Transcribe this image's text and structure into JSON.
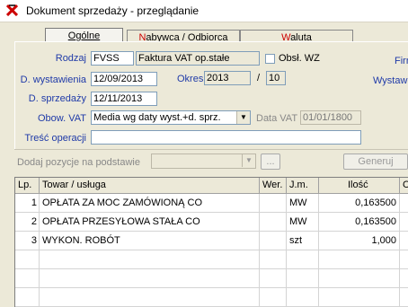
{
  "window": {
    "title": "Dokument sprzedaży  - przeglądanie"
  },
  "tabs": [
    {
      "label_pre": "",
      "hotkey": "O",
      "label_post": "gólne"
    },
    {
      "label_pre": "",
      "hotkey": "N",
      "label_post": "abywca / Odbiorca"
    },
    {
      "label_pre": "",
      "hotkey": "W",
      "label_post": "aluta"
    }
  ],
  "form": {
    "rodzaj_label": "Rodzaj",
    "rodzaj_code": "FVSS",
    "rodzaj_name": "Faktura VAT op.stałe",
    "obsl_wz_label": "Obsł. WZ",
    "firma_label": "Firm",
    "d_wystawienia_label": "D. wystawienia",
    "d_wystawienia": "12/09/2013",
    "okres_label": "Okres",
    "okres_year": "2013",
    "okres_slash": "/",
    "okres_month": "10",
    "wystaw_label": "Wystaw",
    "d_sprzedazy_label": "D. sprzedaży",
    "d_sprzedazy": "12/11/2013",
    "obow_vat_label": "Obow. VAT",
    "obow_vat": "Media wg daty wyst.+d. sprz.",
    "data_vat_label": "Data VAT",
    "data_vat": "01/01/1800",
    "tresc_label": "Treść operacji",
    "tresc": ""
  },
  "toolbar": {
    "dodaj_label": "Dodaj pozycje na podstawie",
    "dodaj_value": "",
    "dots_label": "...",
    "generuj_label": "Generuj"
  },
  "table": {
    "headers": [
      "Lp.",
      "Towar / usługa",
      "Wer.",
      "J.m.",
      "Ilość",
      "C"
    ],
    "rows": [
      {
        "lp": "1",
        "towar": "OPŁATA ZA MOC ZAMÓWIONĄ CO",
        "wer": "",
        "jm": "MW",
        "ilosc": "0,163500"
      },
      {
        "lp": "2",
        "towar": "OPŁATA PRZESYŁOWA STAŁA CO",
        "wer": "",
        "jm": "MW",
        "ilosc": "0,163500"
      },
      {
        "lp": "3",
        "towar": "WYKON. ROBÓT",
        "wer": "",
        "jm": "szt",
        "ilosc": "1,000"
      }
    ]
  }
}
